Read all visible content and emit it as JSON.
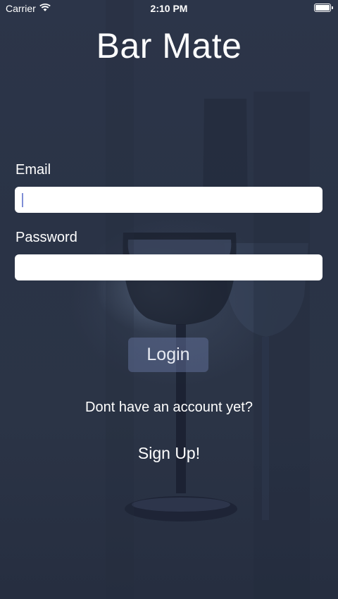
{
  "status_bar": {
    "carrier": "Carrier",
    "time": "2:10 PM",
    "wifi_icon": "wifi-icon",
    "battery_icon": "battery-icon",
    "battery_level": 1.0
  },
  "app": {
    "title": "Bar Mate"
  },
  "form": {
    "email_label": "Email",
    "email_value": "",
    "password_label": "Password",
    "password_value": "",
    "login_label": "Login"
  },
  "signup": {
    "prompt": "Dont have an account yet?",
    "link": "Sign Up!"
  },
  "colors": {
    "background": "#2b3447",
    "text": "#ffffff",
    "input_background": "#ffffff",
    "button_background": "#5f6e96",
    "caret": "#7e8dd6"
  }
}
